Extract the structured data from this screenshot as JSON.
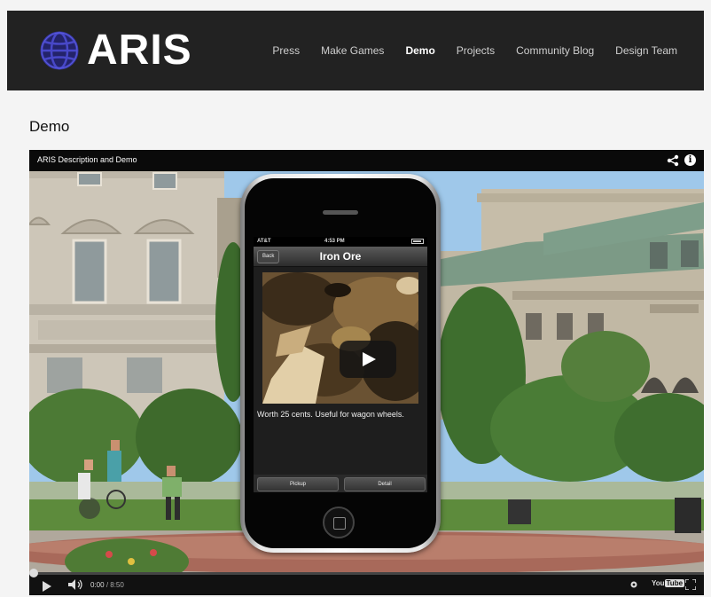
{
  "header": {
    "logo_text": "ARIS",
    "nav": [
      "Press",
      "Make Games",
      "Demo",
      "Projects",
      "Community Blog",
      "Design Team"
    ],
    "active_nav": "Demo"
  },
  "page": {
    "title": "Demo"
  },
  "video": {
    "title": "ARIS Description and Demo",
    "info_label": "i",
    "phone": {
      "carrier": "AT&T",
      "time": "4:53 PM",
      "back_label": "Back",
      "screen_title": "Iron Ore",
      "description": "Worth 25 cents. Useful for wagon wheels.",
      "pickup_label": "Pickup",
      "detail_label": "Detail"
    },
    "controls": {
      "current_time": "0:00",
      "duration": "/ 8:50",
      "progress": 0,
      "youtube_prefix": "You",
      "youtube_tube": "Tube"
    }
  },
  "colors": {
    "header_bg": "#222222",
    "nav_active": "#ffffff",
    "nav_inactive": "#cfcfcf",
    "logo_globe": "#3a3aa8"
  }
}
